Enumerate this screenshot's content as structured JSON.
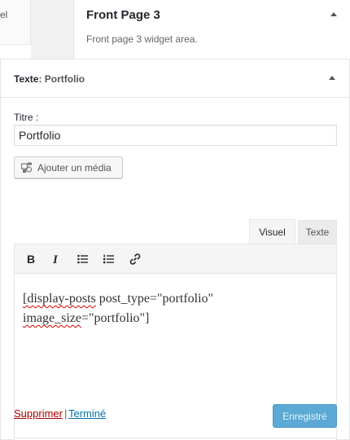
{
  "left_panel": {
    "fragment": "el"
  },
  "sidebar": {
    "title": "Front Page 3",
    "description": "Front page 3 widget area."
  },
  "widget": {
    "type_label": "Texte",
    "name_label": ": Portfolio",
    "title_label": "Titre :",
    "title_value": "Portfolio",
    "add_media_label": "Ajouter un média",
    "tabs": {
      "visual": "Visuel",
      "text": "Texte"
    },
    "toolbar_icons": [
      "bold-icon",
      "italic-icon",
      "bullet-list-icon",
      "numbered-list-icon",
      "link-icon"
    ],
    "content_line1_a": "[display-posts",
    "content_line1_b": " post_type=\"portfolio\"",
    "content_line2_a": "image_size",
    "content_line2_b": "=\"portfolio\"]",
    "delete_label": "Supprimer",
    "separator": "|",
    "done_label": "Terminé",
    "save_label": "Enregistré"
  },
  "colors": {
    "delete_link": "#aa0000",
    "done_link": "#0073aa",
    "save_button": "#5ba9d4"
  }
}
